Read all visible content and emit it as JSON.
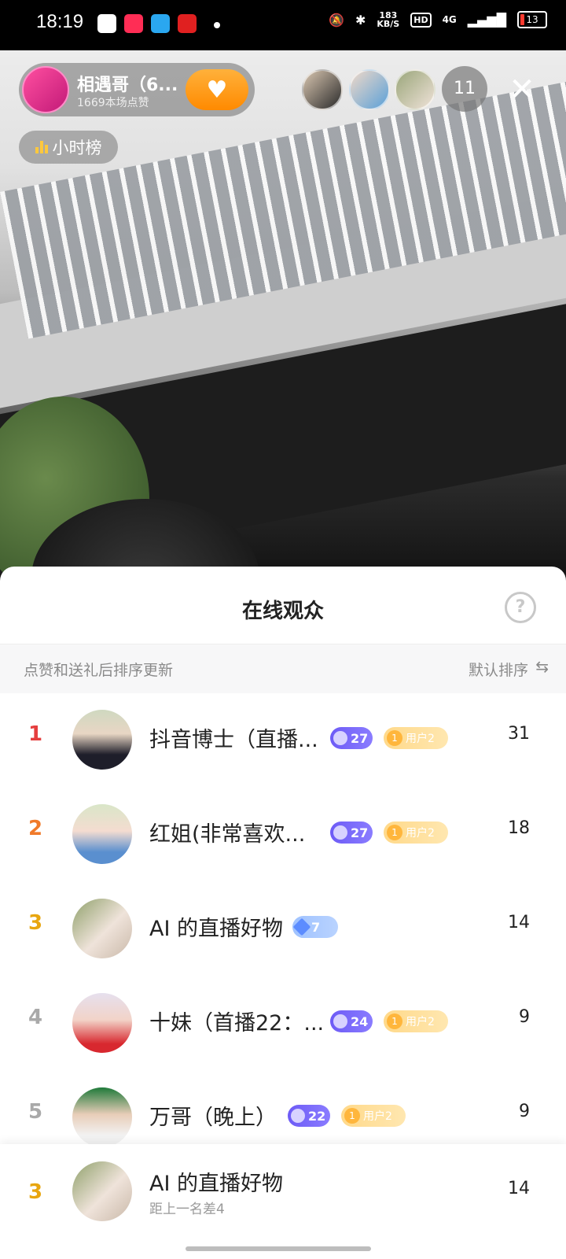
{
  "status_bar": {
    "time": "18:19",
    "speed_value": "183",
    "speed_unit": "KB/S",
    "hd": "HD",
    "network": "4G",
    "battery": "13"
  },
  "live": {
    "host_name": "相遇哥（6...",
    "host_likes": "1669本场点赞",
    "viewer_count": "11",
    "hour_rank_label": "小时榜",
    "colors": {
      "follow": "#ff8a00",
      "pill": "#6e6e6e"
    }
  },
  "sheet": {
    "title": "在线观众",
    "sort_hint": "点赞和送礼后排序更新",
    "sort_label": "默认排序"
  },
  "viewers": [
    {
      "rank": "1",
      "name": "抖音博士（直播...",
      "level": "27",
      "fan_label": "用户2",
      "fan_icon": "1",
      "score": "31",
      "rank_color": "#e53e3e"
    },
    {
      "rank": "2",
      "name": "红姐(非常喜欢...",
      "level": "27",
      "fan_label": "用户2",
      "fan_icon": "1",
      "score": "18",
      "rank_color": "#f07a2a"
    },
    {
      "rank": "3",
      "name": "AI 的直播好物",
      "level": "7",
      "score": "14",
      "rank_color": "#e8a610"
    },
    {
      "rank": "4",
      "name": "十妹（首播22：...",
      "level": "24",
      "fan_label": "用户2",
      "fan_icon": "1",
      "score": "9",
      "rank_color": "#a9a9a9"
    },
    {
      "rank": "5",
      "name": "万哥（晚上）",
      "level": "22",
      "fan_label": "用户2",
      "fan_icon": "1",
      "score": "9",
      "rank_color": "#a9a9a9"
    }
  ],
  "me": {
    "rank": "3",
    "name": "AI 的直播好物",
    "gap_text": "距上一名差4",
    "score": "14"
  }
}
